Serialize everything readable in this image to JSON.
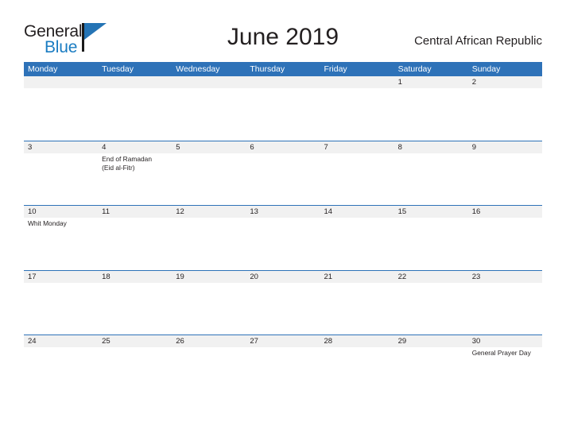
{
  "brand": {
    "word_one": "General",
    "word_two": "Blue",
    "flag_icon": "blue-flag-triangle",
    "accent_color": "#1a7cc2"
  },
  "header": {
    "month_title": "June 2019",
    "country": "Central African Republic"
  },
  "theme": {
    "header_blue": "#2e72b8",
    "band_gray": "#f1f1f1",
    "text_dark": "#231f20"
  },
  "calendar": {
    "weekdays": [
      "Monday",
      "Tuesday",
      "Wednesday",
      "Thursday",
      "Friday",
      "Saturday",
      "Sunday"
    ],
    "weeks": [
      {
        "days": [
          {
            "number": "",
            "events": []
          },
          {
            "number": "",
            "events": []
          },
          {
            "number": "",
            "events": []
          },
          {
            "number": "",
            "events": []
          },
          {
            "number": "",
            "events": []
          },
          {
            "number": "1",
            "events": []
          },
          {
            "number": "2",
            "events": []
          }
        ]
      },
      {
        "days": [
          {
            "number": "3",
            "events": []
          },
          {
            "number": "4",
            "events": [
              "End of Ramadan",
              "(Eid al-Fitr)"
            ]
          },
          {
            "number": "5",
            "events": []
          },
          {
            "number": "6",
            "events": []
          },
          {
            "number": "7",
            "events": []
          },
          {
            "number": "8",
            "events": []
          },
          {
            "number": "9",
            "events": []
          }
        ]
      },
      {
        "days": [
          {
            "number": "10",
            "events": [
              "Whit Monday"
            ]
          },
          {
            "number": "11",
            "events": []
          },
          {
            "number": "12",
            "events": []
          },
          {
            "number": "13",
            "events": []
          },
          {
            "number": "14",
            "events": []
          },
          {
            "number": "15",
            "events": []
          },
          {
            "number": "16",
            "events": []
          }
        ]
      },
      {
        "days": [
          {
            "number": "17",
            "events": []
          },
          {
            "number": "18",
            "events": []
          },
          {
            "number": "19",
            "events": []
          },
          {
            "number": "20",
            "events": []
          },
          {
            "number": "21",
            "events": []
          },
          {
            "number": "22",
            "events": []
          },
          {
            "number": "23",
            "events": []
          }
        ]
      },
      {
        "days": [
          {
            "number": "24",
            "events": []
          },
          {
            "number": "25",
            "events": []
          },
          {
            "number": "26",
            "events": []
          },
          {
            "number": "27",
            "events": []
          },
          {
            "number": "28",
            "events": []
          },
          {
            "number": "29",
            "events": []
          },
          {
            "number": "30",
            "events": [
              "General Prayer Day"
            ]
          }
        ]
      }
    ]
  }
}
